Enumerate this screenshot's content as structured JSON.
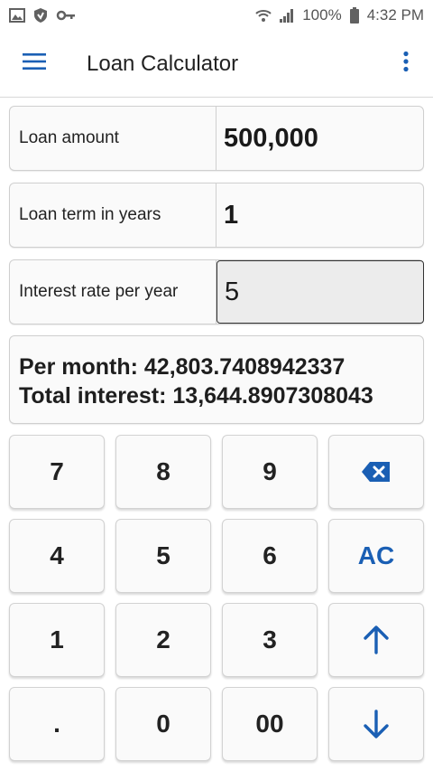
{
  "status_bar": {
    "battery": "100%",
    "time": "4:32 PM",
    "icons": [
      "image-icon",
      "shield-icon",
      "key-icon",
      "wifi-icon",
      "signal-icon",
      "battery-icon"
    ]
  },
  "app_bar": {
    "title": "Loan Calculator",
    "menu_icon": "hamburger-menu-icon",
    "overflow_icon": "more-vert-icon"
  },
  "fields": [
    {
      "label": "Loan amount",
      "value": "500,000"
    },
    {
      "label": "Loan term in years",
      "value": "1"
    },
    {
      "label": "Interest rate per year",
      "value": "5"
    }
  ],
  "result": {
    "per_month": "Per month: 42,803.7408942337",
    "total_interest": "Total interest: 13,644.8907308043"
  },
  "keypad": {
    "row1": [
      "7",
      "8",
      "9"
    ],
    "row2": [
      "4",
      "5",
      "6"
    ],
    "row3": [
      "1",
      "2",
      "3"
    ],
    "row4": [
      ".",
      "0",
      "00"
    ],
    "clear_label": "AC",
    "backspace_icon": "backspace-icon",
    "up_icon": "arrow-up-icon",
    "down_icon": "arrow-down-icon"
  },
  "colors": {
    "accent": "#1a5fb4",
    "text": "#212121",
    "key_bg": "#fafafa",
    "active_field_bg": "#ececec"
  }
}
